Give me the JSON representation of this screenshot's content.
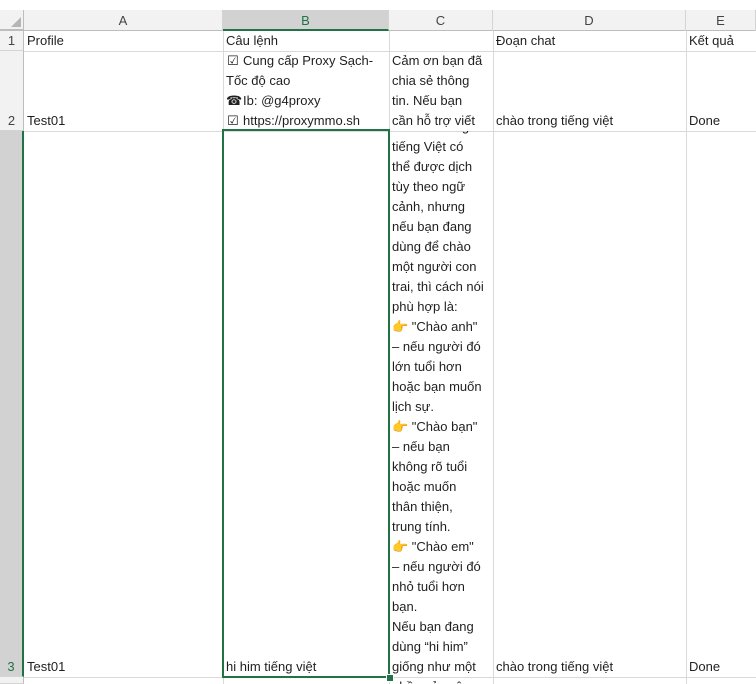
{
  "columns": [
    {
      "letter": "A",
      "selected": false
    },
    {
      "letter": "B",
      "selected": true
    },
    {
      "letter": "C",
      "selected": false
    },
    {
      "letter": "D",
      "selected": false
    },
    {
      "letter": "E",
      "selected": false
    }
  ],
  "rows": [
    {
      "number": "1",
      "selected": false
    },
    {
      "number": "2",
      "selected": true
    },
    {
      "number": "3",
      "selected": true
    }
  ],
  "row1": {
    "a": "Profile",
    "b": "Câu lệnh",
    "c": "",
    "d": "Đoạn chat",
    "e": "Kết quả"
  },
  "row2": {
    "a": "Test01",
    "b_lines": [
      {
        "icon": "☑",
        "text": "Cung cấp Proxy Sạch-"
      },
      {
        "icon": "",
        "text": "Tốc độ cao"
      },
      {
        "icon": "☎",
        "text": "Ib: @g4proxy"
      },
      {
        "icon": "☑",
        "text": "https://proxymmo.sh"
      }
    ],
    "c_lines": [
      "Cảm ơn bạn đã",
      "chia sẻ thông",
      "tin. Nếu bạn",
      "cần hỗ trợ viết"
    ],
    "d": "chào trong tiếng việt",
    "e": "Done"
  },
  "row3": {
    "a": "Test01",
    "b": "hi him tiếng việt",
    "c_lines": [
      "\"hi him\" trong",
      "tiếng Việt có",
      "thể được dịch",
      "tùy theo ngữ",
      "cảnh, nhưng",
      "nếu bạn đang",
      "dùng để chào",
      "một người con",
      "trai, thì cách nói",
      "phù hợp là:",
      "👉 \"Chào anh\"",
      "– nếu người đó",
      "lớn tuổi hơn",
      "hoặc bạn muốn",
      "lịch sự.",
      "👉 \"Chào bạn\"",
      "– nếu bạn",
      "không rõ tuổi",
      "hoặc muốn",
      "thân thiện,",
      "trung tính.",
      "👉 \"Chào em\"",
      "– nếu người đó",
      "nhỏ tuổi hơn",
      "bạn.",
      "Nếu bạn đang",
      "dùng “hi him”",
      "giống như một",
      "phần của câu"
    ],
    "d": "chào trong tiếng việt",
    "e": "Done"
  }
}
